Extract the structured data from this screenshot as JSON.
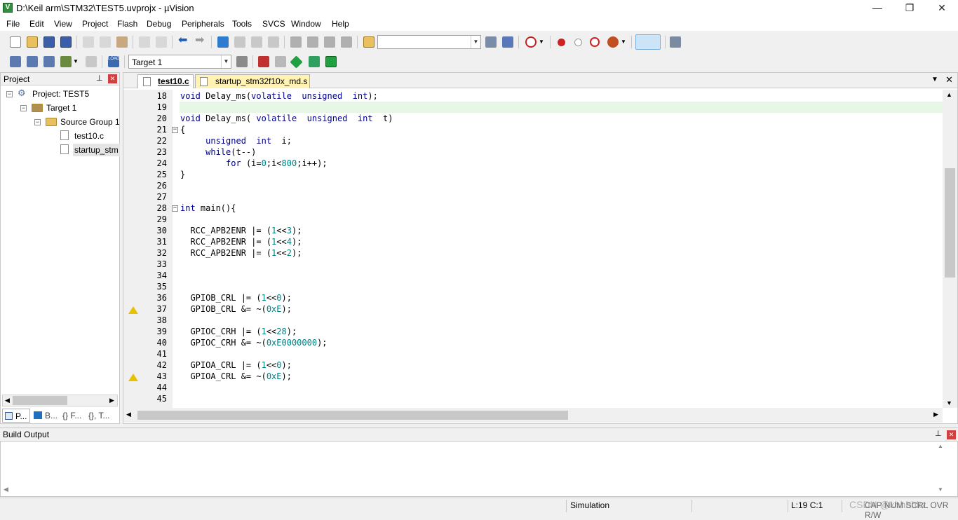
{
  "window": {
    "title": "D:\\Keil arm\\STM32\\TEST5.uvprojx - µVision",
    "app_icon_letter": "V",
    "minimize": "—",
    "maximize": "❐",
    "close": "✕"
  },
  "menu": [
    "File",
    "Edit",
    "View",
    "Project",
    "Flash",
    "Debug",
    "Peripherals",
    "Tools",
    "SVCS",
    "Window",
    "Help"
  ],
  "toolbar2": {
    "target_combo": "Target 1"
  },
  "project_panel": {
    "title": "Project",
    "pin": "ꟷ",
    "close": "✕",
    "tree": [
      {
        "label": "Project: TEST5",
        "expander": "−"
      },
      {
        "label": "Target 1",
        "expander": "−"
      },
      {
        "label": "Source Group 1",
        "expander": "−"
      },
      {
        "label": "test10.c"
      },
      {
        "label": "startup_stm"
      }
    ],
    "bottom_tabs": [
      "P...",
      "B...",
      "{} F...",
      "{}, T..."
    ]
  },
  "editor": {
    "tabs": [
      {
        "label": "test10.c",
        "active": true
      },
      {
        "label": "startup_stm32f10x_md.s",
        "active": false
      }
    ],
    "highlight_line": 19,
    "lines": [
      {
        "n": "18",
        "code": "void Delay_ms(volatile  unsigned  int);"
      },
      {
        "n": "19",
        "code": ""
      },
      {
        "n": "20",
        "code": "void Delay_ms( volatile  unsigned  int  t)"
      },
      {
        "n": "21",
        "code": "{",
        "fold": true
      },
      {
        "n": "22",
        "code": "     unsigned  int  i;"
      },
      {
        "n": "23",
        "code": "     while(t--)"
      },
      {
        "n": "24",
        "code": "         for (i=0;i<800;i++);"
      },
      {
        "n": "25",
        "code": "}"
      },
      {
        "n": "26",
        "code": ""
      },
      {
        "n": "27",
        "code": ""
      },
      {
        "n": "28",
        "code": "int main(){",
        "fold": true
      },
      {
        "n": "29",
        "code": ""
      },
      {
        "n": "30",
        "code": "  RCC_APB2ENR |= (1<<3);"
      },
      {
        "n": "31",
        "code": "  RCC_APB2ENR |= (1<<4);"
      },
      {
        "n": "32",
        "code": "  RCC_APB2ENR |= (1<<2);"
      },
      {
        "n": "33",
        "code": ""
      },
      {
        "n": "34",
        "code": ""
      },
      {
        "n": "35",
        "code": ""
      },
      {
        "n": "36",
        "code": "  GPIOB_CRL |= (1<<0);"
      },
      {
        "n": "37",
        "code": "  GPIOB_CRL &= ~(0xE);",
        "warn": true
      },
      {
        "n": "38",
        "code": ""
      },
      {
        "n": "39",
        "code": "  GPIOC_CRH |= (1<<28);"
      },
      {
        "n": "40",
        "code": "  GPIOC_CRH &= ~(0xE0000000);"
      },
      {
        "n": "41",
        "code": ""
      },
      {
        "n": "42",
        "code": "  GPIOA_CRL |= (1<<0);"
      },
      {
        "n": "43",
        "code": "  GPIOA_CRL &= ~(0xE);",
        "warn": true
      },
      {
        "n": "44",
        "code": ""
      },
      {
        "n": "45",
        "code": ""
      }
    ]
  },
  "build_output": {
    "title": "Build Output"
  },
  "status": {
    "mode": "Simulation",
    "cursor": "L:19 C:1",
    "caps": "CAP NUM SCRL OVR R/W",
    "watermark": "CSDN @khhhhkz"
  },
  "colors": {
    "keyword": "#00008b",
    "number": "#008080",
    "current_line": "#e6f7e6",
    "selection_tab": "#fff2b3"
  }
}
